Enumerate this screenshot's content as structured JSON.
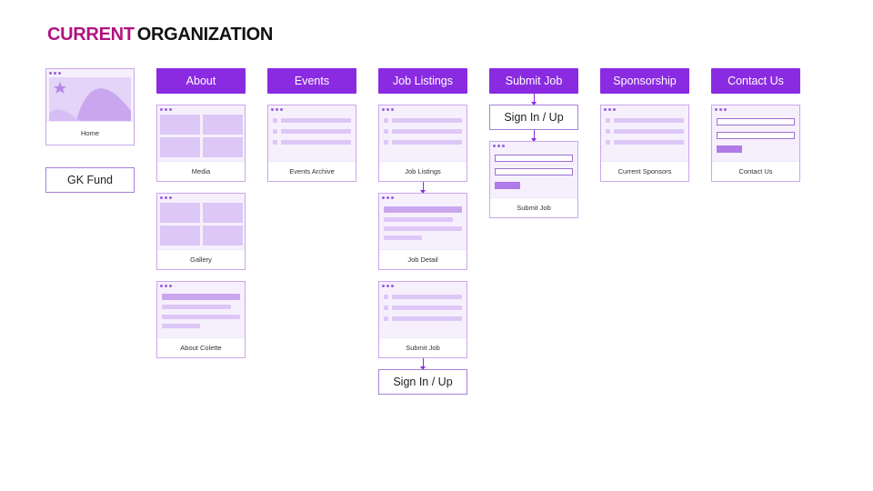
{
  "title": {
    "part1": "CURRENT",
    "part2": "ORGANIZATION"
  },
  "home": {
    "label": "Home"
  },
  "gk_fund": {
    "label": "GK Fund"
  },
  "columns": {
    "about": {
      "label": "About",
      "pages": {
        "media": "Media",
        "gallery": "Gallery",
        "about_colette": "About Colette"
      }
    },
    "events": {
      "label": "Events",
      "pages": {
        "events_archive": "Events Archive"
      }
    },
    "job_listings": {
      "label": "Job Listings",
      "pages": {
        "job_listings": "Job Listings",
        "job_detail": "Job Detail",
        "submit_job": "Submit Job"
      },
      "sign_in": "Sign In / Up"
    },
    "submit_job": {
      "label": "Submit Job",
      "sign_in": "Sign In / Up",
      "pages": {
        "submit_job": "Submit Job"
      }
    },
    "sponsorship": {
      "label": "Sponsorship",
      "pages": {
        "current_sponsors": "Current Sponsors"
      }
    },
    "contact_us": {
      "label": "Contact Us",
      "pages": {
        "contact_us": "Contact Us"
      }
    }
  },
  "colors": {
    "accent": "#8a2be2",
    "title_accent": "#b1127f",
    "wireframe": "#dcc7f6"
  }
}
